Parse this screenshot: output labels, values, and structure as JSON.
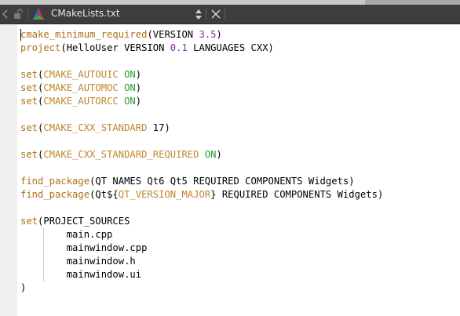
{
  "tab": {
    "file_name": "CMakeLists.txt",
    "file_icon": "cmake-logo-icon",
    "lock_icon": "unlocked-icon",
    "back_icon": "back-arrow-icon",
    "switch_icon": "up-down-arrows-icon",
    "close_icon": "close-icon"
  },
  "colors": {
    "toolbar_bg": "#3d3d3d",
    "command": "#b0701a",
    "variable": "#c0862e",
    "keyword_on": "#2e9a2e",
    "number": "#8a2fa8",
    "text": "#000000"
  },
  "editor": {
    "lines": [
      [
        {
          "t": "cmake_minimum_required",
          "c": "fn"
        },
        {
          "t": "(VERSION ",
          "c": "plain"
        },
        {
          "t": "3.5",
          "c": "num"
        },
        {
          "t": ")",
          "c": "plain"
        }
      ],
      [
        {
          "t": "project",
          "c": "fn"
        },
        {
          "t": "(HelloUser VERSION ",
          "c": "plain"
        },
        {
          "t": "0.1",
          "c": "num"
        },
        {
          "t": " LANGUAGES CXX)",
          "c": "plain"
        }
      ],
      [],
      [
        {
          "t": "set",
          "c": "fn"
        },
        {
          "t": "(",
          "c": "plain"
        },
        {
          "t": "CMAKE_AUTOUIC",
          "c": "var"
        },
        {
          "t": " ",
          "c": "plain"
        },
        {
          "t": "ON",
          "c": "on"
        },
        {
          "t": ")",
          "c": "plain"
        }
      ],
      [
        {
          "t": "set",
          "c": "fn"
        },
        {
          "t": "(",
          "c": "plain"
        },
        {
          "t": "CMAKE_AUTOMOC",
          "c": "var"
        },
        {
          "t": " ",
          "c": "plain"
        },
        {
          "t": "ON",
          "c": "on"
        },
        {
          "t": ")",
          "c": "plain"
        }
      ],
      [
        {
          "t": "set",
          "c": "fn"
        },
        {
          "t": "(",
          "c": "plain"
        },
        {
          "t": "CMAKE_AUTORCC",
          "c": "var"
        },
        {
          "t": " ",
          "c": "plain"
        },
        {
          "t": "ON",
          "c": "on"
        },
        {
          "t": ")",
          "c": "plain"
        }
      ],
      [],
      [
        {
          "t": "set",
          "c": "fn"
        },
        {
          "t": "(",
          "c": "plain"
        },
        {
          "t": "CMAKE_CXX_STANDARD",
          "c": "var"
        },
        {
          "t": " 17)",
          "c": "plain"
        }
      ],
      [],
      [
        {
          "t": "set",
          "c": "fn"
        },
        {
          "t": "(",
          "c": "plain"
        },
        {
          "t": "CMAKE_CXX_STANDARD_REQUIRED",
          "c": "var"
        },
        {
          "t": " ",
          "c": "plain"
        },
        {
          "t": "ON",
          "c": "on"
        },
        {
          "t": ")",
          "c": "plain"
        }
      ],
      [],
      [
        {
          "t": "find_package",
          "c": "fn"
        },
        {
          "t": "(QT NAMES Qt6 Qt5 REQUIRED COMPONENTS Widgets)",
          "c": "plain"
        }
      ],
      [
        {
          "t": "find_package",
          "c": "fn"
        },
        {
          "t": "(Qt${",
          "c": "plain"
        },
        {
          "t": "QT_VERSION_MAJOR",
          "c": "var"
        },
        {
          "t": "} REQUIRED COMPONENTS Widgets)",
          "c": "plain"
        }
      ],
      [],
      [
        {
          "t": "set",
          "c": "fn"
        },
        {
          "t": "(PROJECT_SOURCES",
          "c": "plain"
        }
      ],
      [
        {
          "t": "        main.cpp",
          "c": "plain"
        }
      ],
      [
        {
          "t": "        mainwindow.cpp",
          "c": "plain"
        }
      ],
      [
        {
          "t": "        mainwindow.h",
          "c": "plain"
        }
      ],
      [
        {
          "t": "        mainwindow.ui",
          "c": "plain"
        }
      ],
      [
        {
          "t": ")",
          "c": "plain"
        }
      ]
    ]
  }
}
